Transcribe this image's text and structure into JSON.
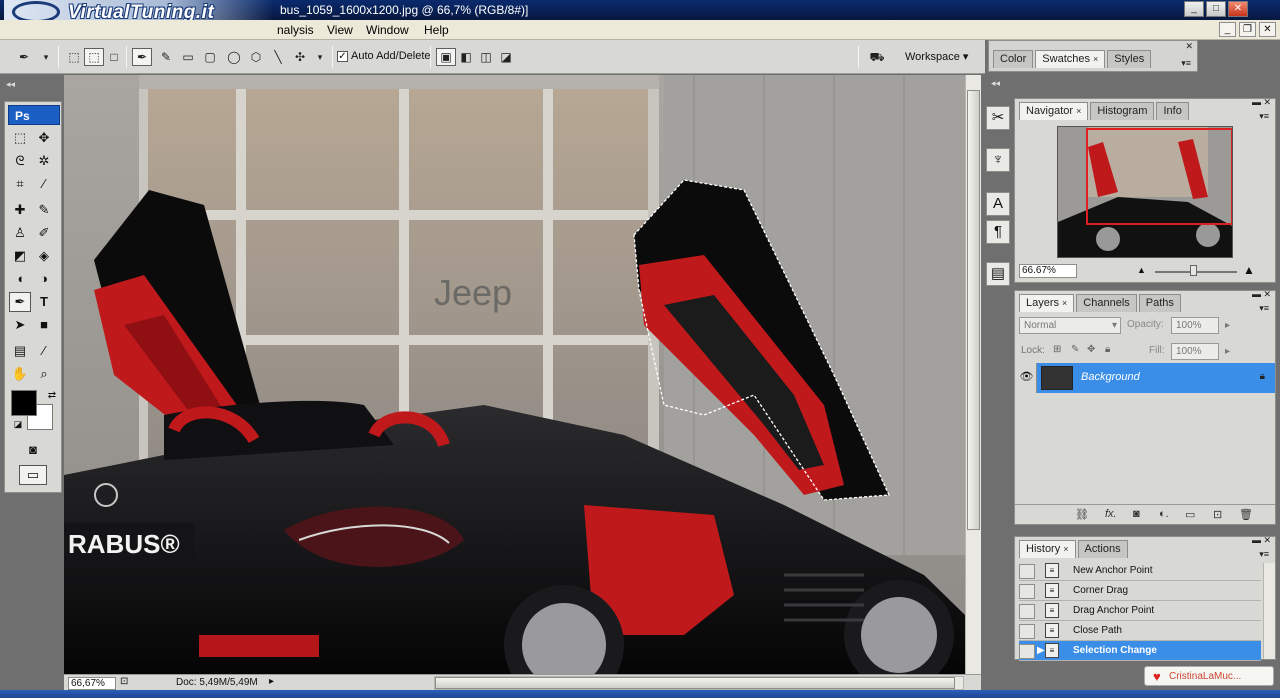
{
  "titlebar": {
    "logo_text": "VirtualTuning.it",
    "doc_title": "bus_1059_1600x1200.jpg @ 66,7% (RGB/8#)]",
    "buttons": [
      "_",
      "□",
      "✕"
    ]
  },
  "menubar": {
    "items": [
      "nalysis",
      "View",
      "Window",
      "Help"
    ]
  },
  "options": {
    "auto_add_label": "Auto Add/Delete",
    "auto_add_checked": "✓",
    "workspace_label": "Workspace ▾"
  },
  "top_panel": {
    "tabs": [
      {
        "label": "Color",
        "close": ""
      },
      {
        "label": "Swatches",
        "close": "×"
      },
      {
        "label": "Styles",
        "close": ""
      }
    ]
  },
  "toolbox": {
    "badge": "Ps"
  },
  "statusbar": {
    "zoom": "66,67%",
    "doc_size": "Doc: 5,49M/5,49M"
  },
  "navigator": {
    "tabs": [
      {
        "label": "Navigator",
        "close": "×"
      },
      {
        "label": "Histogram",
        "close": ""
      },
      {
        "label": "Info",
        "close": ""
      }
    ],
    "zoom": "66.67%"
  },
  "layers": {
    "tabs": [
      {
        "label": "Layers",
        "close": "×"
      },
      {
        "label": "Channels",
        "close": ""
      },
      {
        "label": "Paths",
        "close": ""
      }
    ],
    "blend_mode": "Normal",
    "opacity_label": "Opacity:",
    "opacity_value": "100%",
    "lock_label": "Lock:",
    "fill_label": "Fill:",
    "fill_value": "100%",
    "layer_name": "Background"
  },
  "history": {
    "tabs": [
      {
        "label": "History",
        "close": "×"
      },
      {
        "label": "Actions",
        "close": ""
      }
    ],
    "items": [
      {
        "label": "New Anchor Point"
      },
      {
        "label": "Corner Drag"
      },
      {
        "label": "Drag Anchor Point"
      },
      {
        "label": "Close Path"
      },
      {
        "label": "Selection Change"
      }
    ]
  },
  "watermark": {
    "text": "CristinaLaMuc..."
  },
  "canvas_text": {
    "brand": "RABUS®"
  },
  "colors": {
    "selection": "#3a8ee8",
    "accent_red": "#c0191c",
    "title_bar": "#0a2a6e"
  }
}
